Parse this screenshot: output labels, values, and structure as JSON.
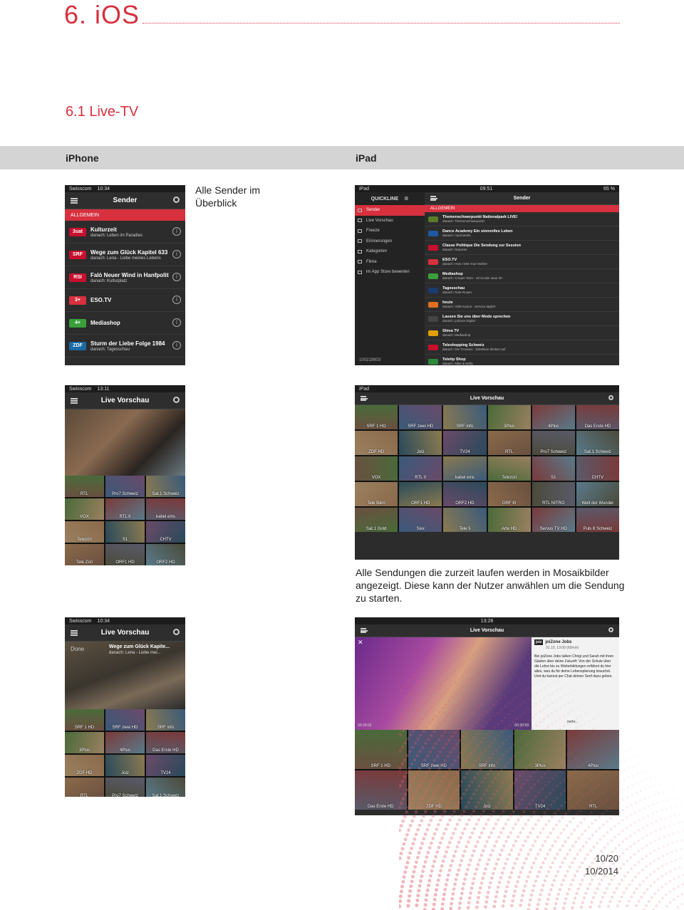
{
  "header": {
    "chapter": "6. iOS",
    "section": "6.1 Live-TV"
  },
  "columns": {
    "iphone": "iPhone",
    "ipad": "iPad"
  },
  "captions": {
    "overview": "Alle Sender im Überblick",
    "mosaic": "Alle Sendungen die zurzeit laufen werden in Mosaikbilder angezeigt. Diese kann der Nutzer anwählen um die Sendung zu starten."
  },
  "iphone1": {
    "carrier": "Swisscom",
    "time": "10:34",
    "title": "Sender",
    "category": "ALLGEMEIN",
    "channels": [
      {
        "logo": "3sat",
        "logo_color": "#c8102e",
        "title": "Kulturzeit",
        "next": "danach: Leben im Paradies"
      },
      {
        "logo": "SRF",
        "logo_color": "#c8102e",
        "title": "Wege zum Glück Kapitel 633",
        "next": "danach: Lena - Liebe meines Lebens"
      },
      {
        "logo": "RSI",
        "logo_color": "#c8102e",
        "title": "Falò Neuer Wind in Hanfpoliti...",
        "next": "danach: Kulturplatz"
      },
      {
        "logo": "3+",
        "logo_color": "#d7303e",
        "title": "ESO.TV",
        "next": ""
      },
      {
        "logo": "4+",
        "logo_color": "#3aa03a",
        "title": "Mediashop",
        "next": ""
      },
      {
        "logo": "ZDF",
        "logo_color": "#1b6aa5",
        "title": "Sturm der Liebe Folge 1984",
        "next": "danach: Tagesschau"
      }
    ]
  },
  "ipad1": {
    "time": "09:51",
    "title": "Sender",
    "category": "ALLGEMEIN",
    "battery": "65 %",
    "menu": [
      "Sender",
      "Live Vorschau",
      "Freeze",
      "Erinnerungen",
      "Kategorien",
      "Filme",
      "im App Store bewerten"
    ],
    "account": "100218903",
    "channels": [
      {
        "title": "Themenschwerpunkt Nationalpark LIVE!",
        "next": "danach: Themenschwerpunkt",
        "logo_color": "#5a7d2a"
      },
      {
        "title": "Dance Academy Ein sinnvolles Leben",
        "next": "danach: mysCamilo",
        "logo_color": "#1d5aa0"
      },
      {
        "title": "Classe Politique Die Sendung zur Session",
        "next": "danach: Reporter",
        "logo_color": "#c8102e"
      },
      {
        "title": "ESO.TV",
        "next": "danach: How I Met Your Mother",
        "logo_color": "#d7303e"
      },
      {
        "title": "Mediashop",
        "next": "danach: Cooper Teen - 40 ist das neue 20",
        "logo_color": "#3aa03a"
      },
      {
        "title": "Tagesschau",
        "next": "danach: Rote Rosen",
        "logo_color": "#1b3c6e"
      },
      {
        "title": "heute",
        "next": "danach: Volle Kanne - Service täglich",
        "logo_color": "#e07020"
      },
      {
        "title": "Lassen Sie uns über Mode sprechen",
        "next": "danach: joiZone Digital",
        "logo_color": "#444"
      },
      {
        "title": "Shiva TV",
        "next": "danach: Mediashop",
        "logo_color": "#e0a000"
      },
      {
        "title": "Teleshopping Schweiz",
        "next": "danach: Die Trovatos - Detektive decken auf",
        "logo_color": "#c8102e"
      },
      {
        "title": "Teletip Shop",
        "next": "danach: Mike & Molly",
        "logo_color": "#2a8a3a"
      }
    ]
  },
  "iphone2": {
    "carrier": "Swisscom",
    "time": "13:11",
    "title": "Live Vorschau",
    "tiles": [
      "RTL",
      "Pro7 Schweiz",
      "Sat.1 Schweiz",
      "VOX",
      "RTL II",
      "kabel eins",
      "Telezüri",
      "S1",
      "CHTV",
      "Tele Züri",
      "ORF1 HD",
      "ORF2 HD"
    ]
  },
  "ipad2": {
    "title": "Live Vorschau",
    "tiles": [
      "SRF 1 HD",
      "SRF zwei HD",
      "SRF info",
      "3Plus",
      "4Plus",
      "Das Erste HD",
      "ZDF HD",
      "Joiz",
      "TV24",
      "RTL",
      "Pro7 Schweiz",
      "Sat.1 Schweiz",
      "VOX",
      "RTL II",
      "kabel eins",
      "Telezüri",
      "S1",
      "CHTV",
      "Tele Bärn",
      "ORF1 HD",
      "ORF2 HD",
      "ORF III",
      "RTL NITRO",
      "Welt der Wunder",
      "Sat.1 Gold",
      "Sixx",
      "Tele 5",
      "Arte HD",
      "Servus TV HD",
      "Puls 8 Schweiz"
    ]
  },
  "iphone3": {
    "carrier": "Swisscom",
    "time": "10:34",
    "title": "Live Vorschau",
    "done": "Done",
    "show": "Wege zum Glück Kapite...",
    "next": "danach: Lena - Liebe mei...",
    "tiles": [
      "SRF 1 HD",
      "SRF zwei HD",
      "SRF info",
      "3Plus",
      "4Plus",
      "Das Erste HD",
      "ZDF HD",
      "Joiz",
      "TV24",
      "RTL",
      "Pro7 Schweiz",
      "Sat.1 Schweiz"
    ]
  },
  "ipad3": {
    "time": "13:28",
    "title": "Live Vorschau",
    "channel": "joiz",
    "show": "joiZone Jobs",
    "when": "01.10, 13:00 (60min)",
    "desc": "Bei joiZone Jobs talken Chrigi und Sarah mit ihren Gästen über deine Zukunft: Von der Schule über die Lehre bis zu Weiterbildungen erfährst du hier alles, was du für deine Lebensplanung brauchst. Und du kannst per Chat deinen Senf dazu geben.",
    "more": "mehr...",
    "elapsed": "00:29:02",
    "remaining": "-00:30:58",
    "tiles": [
      "SRF 1 HD",
      "SRF zwei HD",
      "SRF info",
      "3Plus",
      "4Plus",
      "Das Erste HD",
      "ZDF HD",
      "Joiz",
      "TV24",
      "RTL"
    ]
  },
  "footer": {
    "page": "10/20",
    "date": "10/2014"
  }
}
